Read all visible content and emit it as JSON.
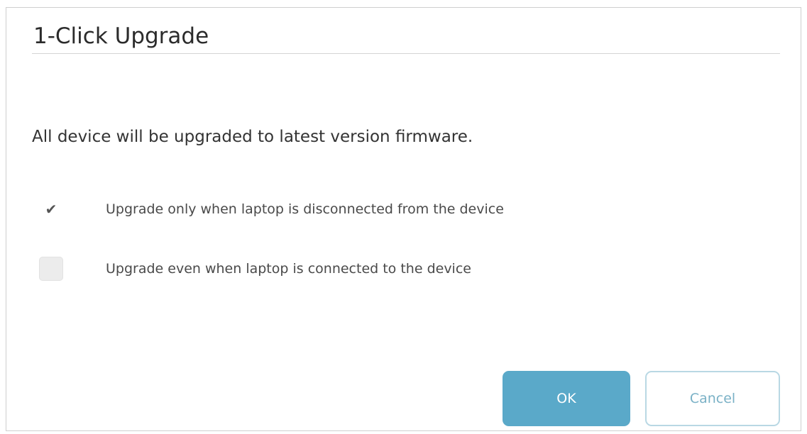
{
  "dialog": {
    "title": "1-Click Upgrade",
    "message": "All device will be upgraded to latest version firmware.",
    "options": [
      {
        "label": "Upgrade only when laptop is disconnected from the device",
        "checked": true,
        "indicator": "✔"
      },
      {
        "label": "Upgrade even when laptop is connected to the device",
        "checked": false
      }
    ],
    "buttons": {
      "ok_label": "OK",
      "cancel_label": "Cancel"
    }
  },
  "colors": {
    "primary_button": "#5aa9c9",
    "secondary_border": "#b9d8e4",
    "secondary_text": "#7ab1c6"
  }
}
